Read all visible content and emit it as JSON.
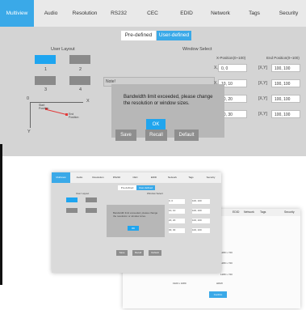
{
  "tabs": [
    {
      "label": "Multiview",
      "active": true
    },
    {
      "label": "Audio"
    },
    {
      "label": "Resolution"
    },
    {
      "label": "RS232"
    },
    {
      "label": "CEC"
    },
    {
      "label": "EDID"
    },
    {
      "label": "Network"
    },
    {
      "label": "Tags"
    },
    {
      "label": "Security"
    }
  ],
  "mode": {
    "predefined": "Pre-defined",
    "userdefined": "User-defined",
    "selected": "User-defined"
  },
  "user_layout": {
    "title": "User Layout",
    "blocks": [
      "1",
      "2",
      "3",
      "4"
    ],
    "selected_block": "1"
  },
  "axes": {
    "origin": "0",
    "x": "X",
    "y": "Y",
    "start_position": "Start Position",
    "end_position": "End Position"
  },
  "window_select": {
    "title": "Window Select",
    "note_label": "Note!",
    "start_header": "X-Position(0~100)",
    "end_header": "End Position(0~100)",
    "x_prefix": "X",
    "y_prefix": "Y",
    "rows": [
      {
        "start": "0, 0",
        "end": "100, 100"
      },
      {
        "start": "10, 10",
        "end": "100, 100"
      },
      {
        "start": "20, 20",
        "end": "100, 100"
      },
      {
        "start": "30, 30",
        "end": "100, 100"
      }
    ]
  },
  "dialog": {
    "message": "Bandwidth limit exceeded, please change the resolution or window sizes.",
    "ok": "OK"
  },
  "actions": {
    "save": "Save",
    "recall": "Recall",
    "default": "Default"
  },
  "back_window": {
    "tabs": [
      "EDID",
      "Network",
      "Tags",
      "Security"
    ],
    "rows": [
      "1280 x 720",
      "1280 x 720",
      "1280 x 720"
    ],
    "resolution": "1920 x 1080",
    "hdmi_label": "HDMI",
    "apply": "Confirm"
  },
  "colors": {
    "accent": "#3aa9e8",
    "panel": "#d4d4d4",
    "block": "#8a8a8a",
    "button": "#8e8e8e"
  }
}
